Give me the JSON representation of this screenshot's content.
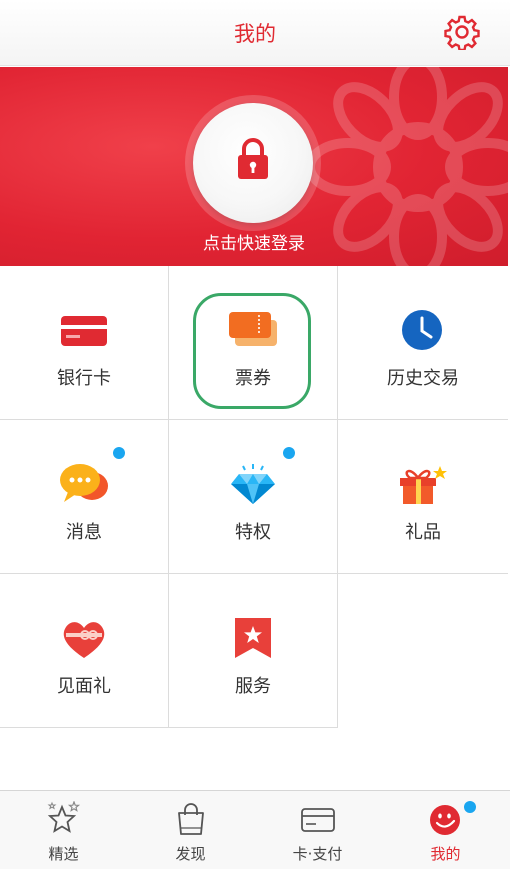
{
  "header": {
    "title": "我的",
    "settings_icon": "gear-icon"
  },
  "banner": {
    "login_text": "点击快速登录",
    "lock_icon": "lock-icon"
  },
  "grid": {
    "items": [
      {
        "label": "银行卡",
        "icon": "bank-card-icon"
      },
      {
        "label": "票券",
        "icon": "ticket-icon"
      },
      {
        "label": "历史交易",
        "icon": "clock-icon"
      },
      {
        "label": "消息",
        "icon": "message-icon",
        "badge": true
      },
      {
        "label": "特权",
        "icon": "diamond-icon",
        "badge": true
      },
      {
        "label": "礼品",
        "icon": "gift-icon"
      },
      {
        "label": "见面礼",
        "icon": "heart-gift-icon"
      },
      {
        "label": "服务",
        "icon": "star-bookmark-icon"
      }
    ]
  },
  "tabbar": {
    "tabs": [
      {
        "label": "精选",
        "icon": "star-icon"
      },
      {
        "label": "发现",
        "icon": "shopping-bag-icon"
      },
      {
        "label": "卡·支付",
        "icon": "card-icon"
      },
      {
        "label": "我的",
        "icon": "smiley-icon",
        "active": true,
        "badge": true
      }
    ]
  },
  "colors": {
    "brand_red": "#e02a32",
    "badge_blue": "#1aa6f0",
    "highlight_green": "#3aa867"
  }
}
